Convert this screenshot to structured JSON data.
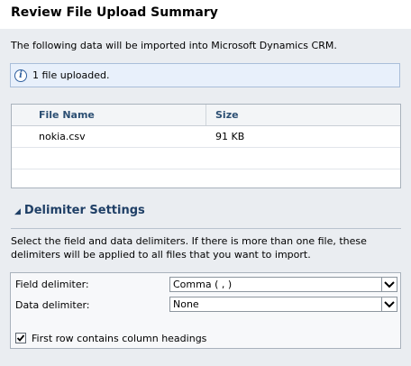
{
  "header": {
    "title": "Review File Upload Summary"
  },
  "intro": "The following data will be imported into Microsoft Dynamics CRM.",
  "notice": {
    "icon": "info-icon",
    "text": "1 file uploaded."
  },
  "file_table": {
    "columns": [
      "File Name",
      "Size"
    ],
    "rows": [
      {
        "name": "nokia.csv",
        "size": "91 KB"
      }
    ]
  },
  "delimiter_section": {
    "title": "Delimiter Settings",
    "description": "Select the field and data delimiters. If there is more than one file, these delimiters will be applied to all files that you want to import.",
    "field_delimiter": {
      "label": "Field delimiter:",
      "value": "Comma ( , )"
    },
    "data_delimiter": {
      "label": "Data delimiter:",
      "value": "None"
    },
    "first_row": {
      "label": "First row contains column headings",
      "checked": true
    }
  }
}
